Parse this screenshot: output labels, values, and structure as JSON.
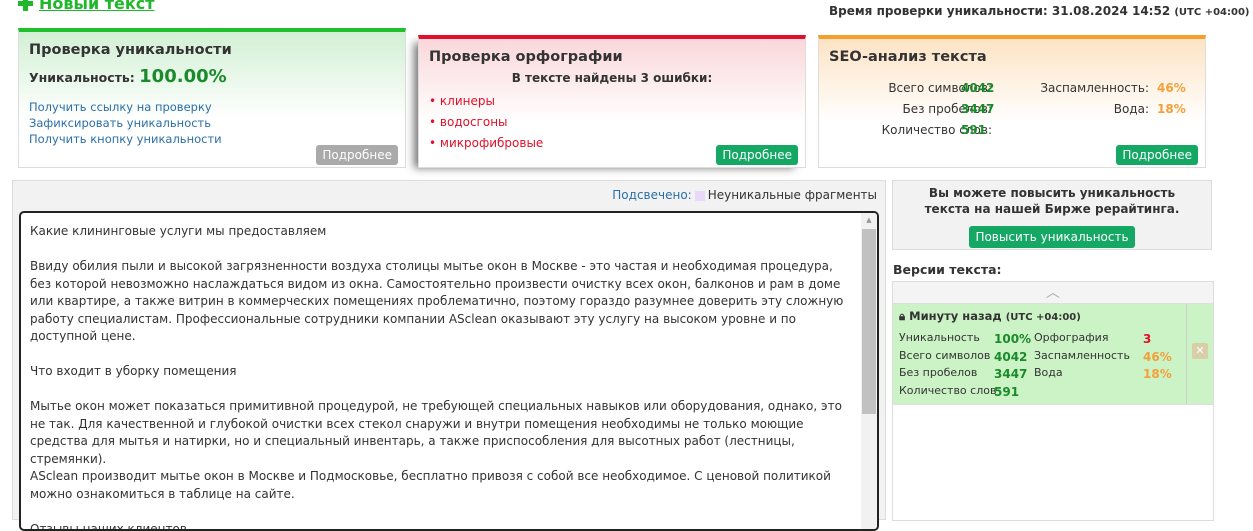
{
  "header": {
    "new_text": "Новый текст",
    "time_label": "Время проверки уникальности: 31.08.2024 14:52",
    "tz": "(UTC +04:00)"
  },
  "uniq": {
    "title": "Проверка уникальности",
    "label": "Уникальность:",
    "value": "100.00%",
    "links": [
      "Получить ссылку на проверку",
      "Зафиксировать уникальность",
      "Получить кнопку уникальности"
    ],
    "more": "Подробнее"
  },
  "spell": {
    "title": "Проверка орфографии",
    "subtitle": "В тексте найдены 3 ошибки:",
    "errors": [
      "клинеры",
      "водосгоны",
      "микрофибровые"
    ],
    "more": "Подробнее"
  },
  "seo": {
    "title": "SEO-анализ текста",
    "chars_label": "Всего символов:",
    "chars": "4042",
    "nospace_label": "Без пробелов:",
    "nospace": "3447",
    "words_label": "Количество слов:",
    "words": "591",
    "spam_label": "Заспамленность:",
    "spam": "46%",
    "water_label": "Вода:",
    "water": "18%",
    "more": "Подробнее"
  },
  "legend": {
    "label": "Подсвечено:",
    "item": "Неуникальные фрагменты"
  },
  "text": [
    "Какие клининговые услуги мы предоставляем",
    "Ввиду обилия пыли и высокой загрязненности воздуха столицы мытье окон в Москве - это частая и необходимая процедура, без которой невозможно наслаждаться видом из окна. Самостоятельно произвести очистку всех окон, балконов и рам в доме или квартире, а также витрин в коммерческих помещениях проблематично, поэтому гораздо разумнее доверить эту сложную работу специалистам. Профессиональные сотрудники компании ASclean оказывают эту услугу на высоком уровне и по доступной цене.",
    "Что входит в уборку помещения",
    "Мытье окон может показаться примитивной процедурой, не требующей специальных навыков или оборудования, однако, это не так. Для качественной и глубокой очистки всех стекол снаружи и внутри помещения необходимы не только моющие средства для мытья и натирки, но и специальный инвентарь, а также приспособления для высотных работ (лестницы, стремянки).",
    "ASclean производит мытье окон в Москве и Подмосковье, бесплатно привозя с собой все необходимое. С ценовой политикой можно ознакомиться в таблице на сайте.",
    "Отзывы наших клиентов"
  ],
  "promo": {
    "text": "Вы можете повысить уникальность текста на нашей Бирже рерайтинга.",
    "button": "Повысить уникальность"
  },
  "versions": {
    "title": "Версии текста:",
    "entry": {
      "time": "Минуту назад",
      "tz": "(UTC +04:00)",
      "uniq_label": "Уникальность",
      "uniq": "100%",
      "spell_label": "Орфография",
      "spell": "3",
      "chars_label": "Всего символов",
      "chars": "4042",
      "spam_label": "Заспамленность",
      "spam": "46%",
      "nospace_label": "Без пробелов",
      "nospace": "3447",
      "water_label": "Вода",
      "water": "18%",
      "words_label": "Количество слов",
      "words": "591"
    }
  },
  "colors": {
    "green": "#15a865",
    "red": "#e0102a",
    "orange": "#f4a02a"
  }
}
